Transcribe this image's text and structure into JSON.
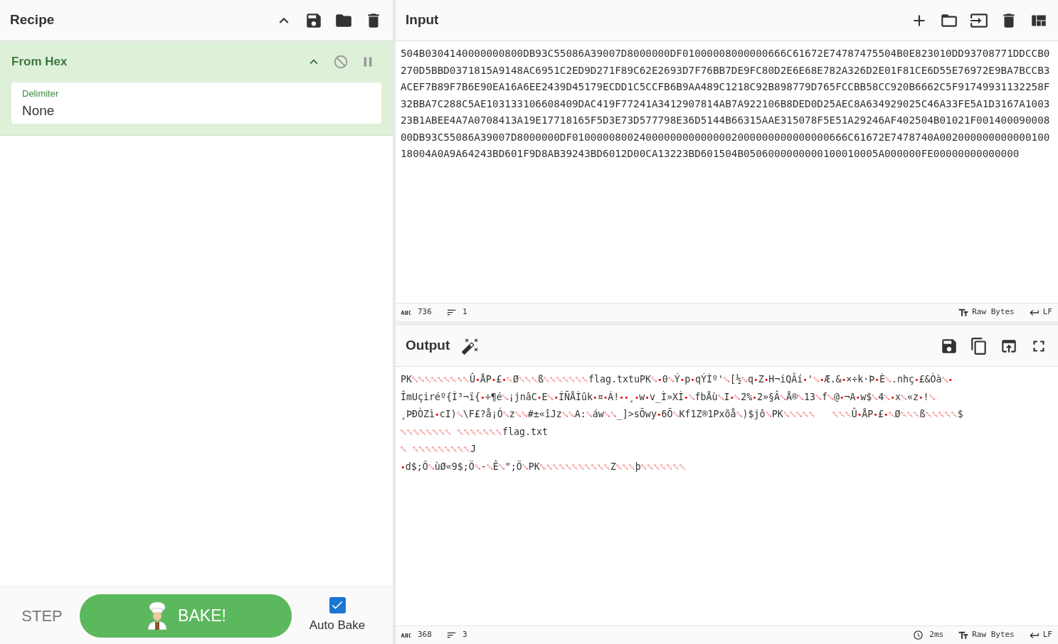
{
  "recipe": {
    "title": "Recipe",
    "operations": [
      {
        "name": "From Hex",
        "expanded": true,
        "disabled": false,
        "breakpoint": false,
        "args": [
          {
            "label": "Delimiter",
            "value": "None"
          }
        ]
      }
    ]
  },
  "controls": {
    "step": "STEP",
    "bake": "BAKE!",
    "auto_bake": {
      "label": "Auto Bake",
      "checked": true
    }
  },
  "input": {
    "title": "Input",
    "text": "504B0304140000000800DB93C55086A39007D8000000DF01000008000000666C61672E74787475504B0E823010DD93708771DDCCB0270D5BBD0371815A9148AC6951C2ED9D271F89C62E2693D7F76BB7DE9FC80D2E6E68E782A326D2E01F81CE6D55E76972E9BA7BCCB3ACEF7B89F7B6E90EA16A6EE2439D45179ECDD1C5CCFB6B9AA489C1218C92B898779D765FCCBB58CC920B6662C5F91749931132258F32BBA7C288C5AE103133106608409DAC419F77241A3412907814AB7A922106B8DED0D25AEC8A634929025C46A33FE5A1D3167A100323B1ABEE4A7A0708413A19E17718165F5D3E73D577798E36D5144B66315AAE315078F5E51A29246AF402504B01021F00140009000800DB93C55086A39007D8000000DF010000080024000000000000002000000000000000666C61672E7478740A00200000000000010018004A0A9A64243BD601F9D8AB39243BD6012D00CA13223BD601504B0506000000000100010005A000000FE00000000000000",
    "status": {
      "length": "736",
      "lines": "1",
      "encoding": "Raw Bytes",
      "eol": "LF"
    }
  },
  "output": {
    "title": "Output",
    "lines": [
      "PK␃␄␔␀␀␀␀␈␀Û•ÅP•£•␀Ø␀␀␀ß␀␀␀␀␀␀␀flag.txtuPK␁•0␁Ý•p•qÝÌº'␁[½␁q•Z•H¬iQÂí•'␁•Æ.&•×÷k·Þ•È␁.nhç•£&Òà␁•",
      "ÎmUçiréº{Ì³¬ï{•÷¶é␁¡jnâC•E␁•ÍÑÅÌûk•¤•Á!••¸•w•v_Ì»XÌ•␁fbÅù␁I•␁2%•2»§Â␁Å®␁13␁f␁@•¬A•w$␁4␁•x␁«z•!␁",
      "¸ÞÐÒZì•cI)␁\\F£?å¡Ó␁z␁␁#±«îJz␁␁A:␁áw␁␁_]>sÕwy•6Õ␁Kf1Z®1Pxõå␁)$jô␁PK␁␂␁␀␀   ␀␀␀Û•ÅP•£•␀Ø␀␀␀ß␀␀␀␀␀$",
      "␀␀␀␀␀␀␀␀ ␀␀␀␀␀␀␀flag.txt",
      "␀ ␀␀␀␀␀␀␀␀␀J",
      "•d$;Ö␁ùØ«9$;Ö␁-␁Ê␁\";Ö␁PK␅␆␀␀␀␀␀␀␀␀␀Z␀␀␀þ␀␀␀␀␀␀␀"
    ],
    "status": {
      "length": "368",
      "lines": "3",
      "time": "2ms",
      "encoding": "Raw Bytes",
      "eol": "LF"
    }
  }
}
